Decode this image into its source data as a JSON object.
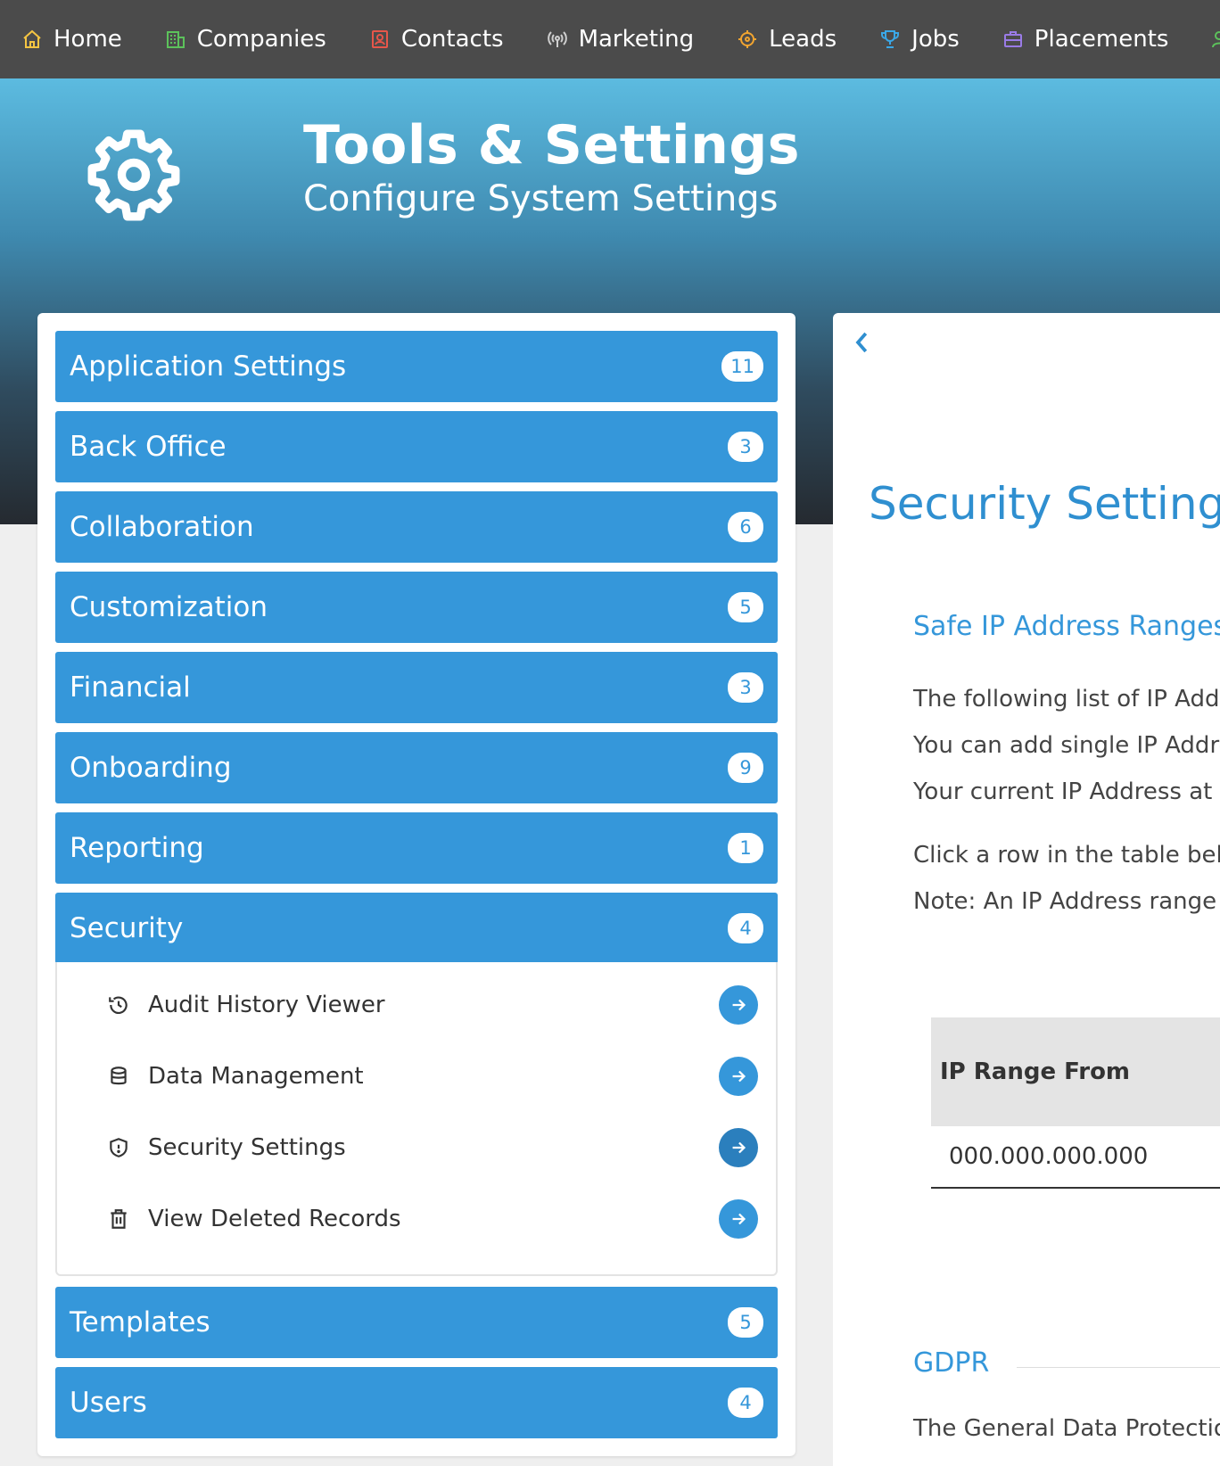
{
  "nav": {
    "items": [
      {
        "label": "Home",
        "icon": "home-icon",
        "color": "#f5c542"
      },
      {
        "label": "Companies",
        "icon": "building-icon",
        "color": "#5cc25b"
      },
      {
        "label": "Contacts",
        "icon": "contact-card-icon",
        "color": "#e8564a"
      },
      {
        "label": "Marketing",
        "icon": "broadcast-icon",
        "color": "#cfcfcf"
      },
      {
        "label": "Leads",
        "icon": "target-icon",
        "color": "#f2a530"
      },
      {
        "label": "Jobs",
        "icon": "trophy-icon",
        "color": "#3aa8e8"
      },
      {
        "label": "Placements",
        "icon": "briefcase-icon",
        "color": "#9a7be6"
      },
      {
        "label": "",
        "icon": "users-icon",
        "color": "#5cc25b"
      }
    ]
  },
  "hero": {
    "title": "Tools & Settings",
    "subtitle": "Configure System Settings",
    "icon": "gear-icon"
  },
  "categories": [
    {
      "label": "Application Settings",
      "count": "11"
    },
    {
      "label": "Back Office",
      "count": "3"
    },
    {
      "label": "Collaboration",
      "count": "6"
    },
    {
      "label": "Customization",
      "count": "5"
    },
    {
      "label": "Financial",
      "count": "3"
    },
    {
      "label": "Onboarding",
      "count": "9"
    },
    {
      "label": "Reporting",
      "count": "1"
    },
    {
      "label": "Security",
      "count": "4"
    },
    {
      "label": "Templates",
      "count": "5"
    },
    {
      "label": "Users",
      "count": "4"
    }
  ],
  "security_items": [
    {
      "label": "Audit History Viewer",
      "icon": "history-icon"
    },
    {
      "label": "Data Management",
      "icon": "database-icon"
    },
    {
      "label": "Security Settings",
      "icon": "shield-icon"
    },
    {
      "label": "View Deleted Records",
      "icon": "trash-icon"
    }
  ],
  "main": {
    "title": "Security Settings",
    "safe_ip_title": "Safe IP Address Ranges",
    "paragraphs": [
      "The following list of IP Addre",
      "You can add single IP Addre",
      "Your current IP Address at th",
      "Click a row in the table belov",
      "Note: An IP Address range o"
    ],
    "table": {
      "header": "IP Range From",
      "row_value": "000.000.000.000"
    },
    "gdpr_title": "GDPR",
    "gdpr_text": "The General Data Protection"
  },
  "colors": {
    "accent": "#3597da",
    "nav_bg": "#4b4b4b"
  }
}
